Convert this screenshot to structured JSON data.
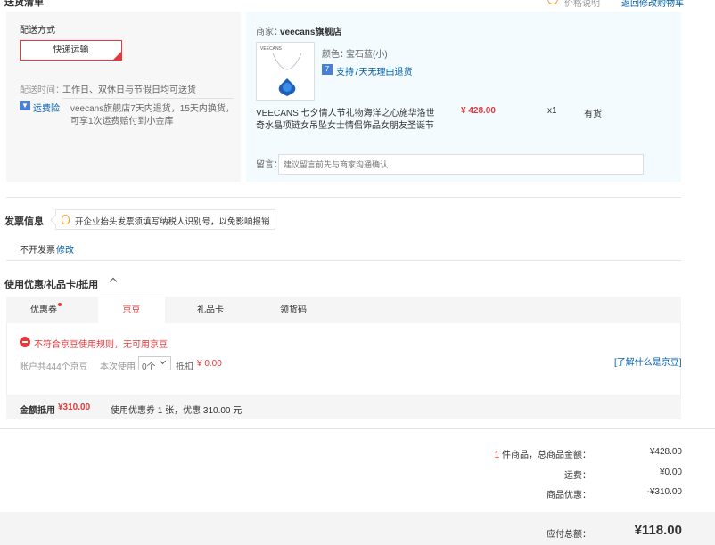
{
  "header": {
    "section_title": "送货清单",
    "price_note": "价格说明",
    "back_link": "返回修改购物车"
  },
  "delivery": {
    "label": "配送方式",
    "method": "快递运输",
    "time_label": "配送时间：",
    "time_value": "工作日、双休日与节假日均可送货",
    "insurance_name": "运费险",
    "insurance_line1": "veecans旗舰店7天内退货，15天内换货，",
    "insurance_line2": "可享1次运费赔付到小金库"
  },
  "shop": {
    "merchant_label": "商家：",
    "merchant_name": "veecans旗舰店",
    "image_brand": "VEECANS",
    "color_label": "颜色：",
    "color_value": "宝石蓝(小)",
    "return_policy": "支持7天无理由退货",
    "title_line1": "VEECANS 七夕情人节礼物海洋之心施华洛世",
    "title_line2": "奇水晶项链女吊坠女士情侣饰品女朋友圣诞节",
    "price": "¥ 428.00",
    "qty": "x1",
    "stock": "有货",
    "note_label": "留言：",
    "note_placeholder": "建议留言前先与商家沟通确认"
  },
  "invoice": {
    "title": "发票信息",
    "tip": "开企业抬头发票须填写纳税人识别号，以免影响报销",
    "value": "不开发票",
    "edit": "修改"
  },
  "coupon": {
    "title": "使用优惠/礼品卡/抵用",
    "tabs": [
      "优惠券",
      "京豆",
      "礼品卡",
      "领货码"
    ],
    "active_tab": "京豆",
    "error": "不符合京豆使用规则，无可用京豆",
    "balance": "账户共444个京豆",
    "use_label": "本次使用",
    "use_value": "0个",
    "deduct_label": "抵扣",
    "deduct_value": "¥ 0.00",
    "learn_more": "[了解什么是京豆]",
    "summary_label": "金额抵用",
    "summary_amount": "¥310.00",
    "summary_text": "使用优惠券 1 张，优惠 310.00 元"
  },
  "totals": {
    "count": "1",
    "count_suffix": "件商品，总商品金额：",
    "goods_amount": "¥428.00",
    "freight_label": "运费：",
    "freight": "¥0.00",
    "discount_label": "商品优惠：",
    "discount": "-¥310.00",
    "payable_label": "应付总额：",
    "payable": "¥118.00"
  },
  "colors": {
    "accent": "#e4393c",
    "link": "#005ea7",
    "panel": "#f3fbfe"
  }
}
